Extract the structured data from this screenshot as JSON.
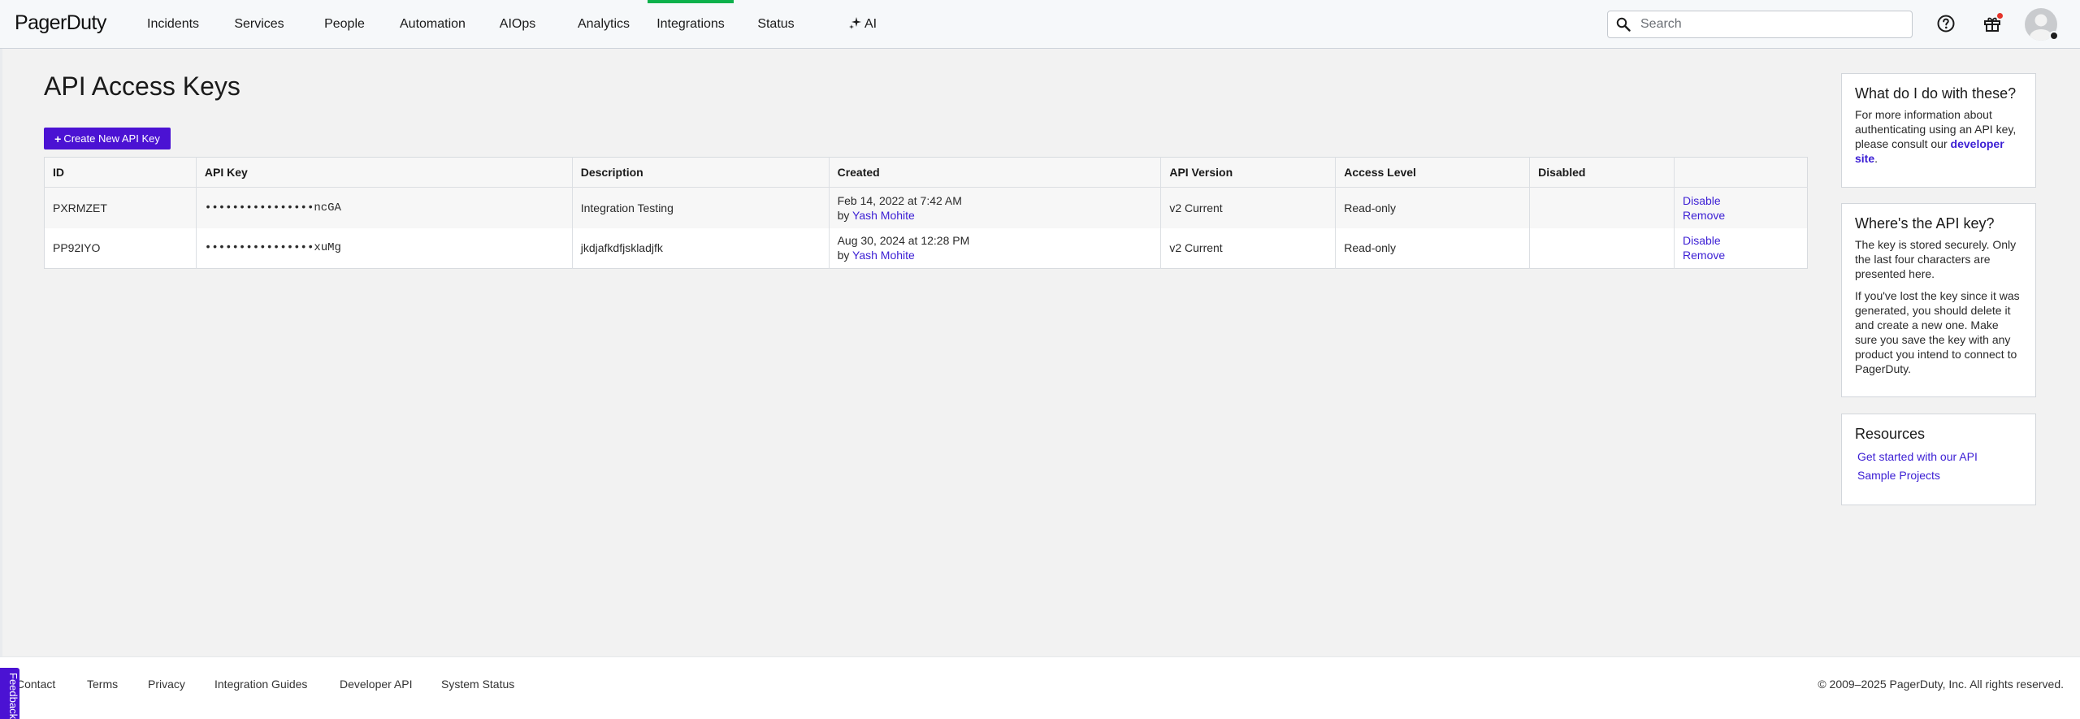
{
  "header": {
    "logo": "PagerDuty",
    "nav": [
      {
        "label": "Incidents",
        "active": false
      },
      {
        "label": "Services",
        "active": false
      },
      {
        "label": "People",
        "active": false
      },
      {
        "label": "Automation",
        "active": false
      },
      {
        "label": "AIOps",
        "active": false
      },
      {
        "label": "Analytics",
        "active": false
      },
      {
        "label": "Integrations",
        "active": true
      },
      {
        "label": "Status",
        "active": false
      },
      {
        "label": "AI",
        "active": false
      }
    ],
    "search_placeholder": "Search",
    "search_value": "",
    "accent_color": "#0cb14b"
  },
  "main": {
    "title": "API Access Keys",
    "create_button_label": "Create New API Key",
    "button_color": "#4b12d3",
    "table": {
      "columns": [
        "ID",
        "API Key",
        "Description",
        "Created",
        "API Version",
        "Access Level",
        "Disabled",
        ""
      ],
      "rows": [
        {
          "id": "PXRMZET",
          "api_key": "••••••••••••••••ncGA",
          "description": "Integration Testing",
          "created_date": "Feb 14, 2022 at 7:42 AM",
          "created_by_prefix": "by",
          "created_by": "Yash Mohite",
          "api_version": "v2 Current",
          "access_level": "Read-only",
          "disabled": "",
          "action_disable": "Disable",
          "action_remove": "Remove"
        },
        {
          "id": "PP92IYO",
          "api_key": "••••••••••••••••xuMg",
          "description": "jkdjafkdfjskladjfk",
          "created_date": "Aug 30, 2024 at 12:28 PM",
          "created_by_prefix": "by",
          "created_by": "Yash Mohite",
          "api_version": "v2 Current",
          "access_level": "Read-only",
          "disabled": "",
          "action_disable": "Disable",
          "action_remove": "Remove"
        }
      ]
    }
  },
  "sidebar": {
    "panel1": {
      "title": "What do I do with these?",
      "text": "For more information about authenticating using an API key, please consult our",
      "link": "developer site",
      "text_end": "."
    },
    "panel2": {
      "title": "Where's the API key?",
      "paragraph1": "The key is stored securely. Only the last four characters are presented here.",
      "paragraph2": "If you've lost the key since it was generated, you should delete it and create a new one. Make sure you save the key with any product you intend to connect to PagerDuty."
    },
    "panel3": {
      "title": "Resources",
      "links": [
        "Get started with our API",
        "Sample Projects"
      ]
    }
  },
  "footer": {
    "links": [
      "Contact",
      "Terms",
      "Privacy",
      "Integration Guides",
      "Developer API",
      "System Status"
    ],
    "copyright": "© 2009–2025 PagerDuty, Inc. All rights reserved.",
    "feedback_label": "Feedback"
  }
}
